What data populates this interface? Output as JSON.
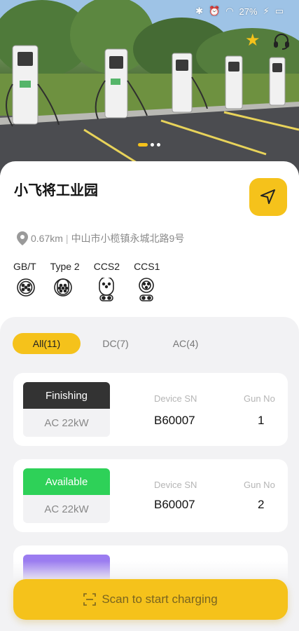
{
  "status_bar": {
    "battery": "27%"
  },
  "station": {
    "name": "小飞将工业园",
    "distance": "0.67km",
    "address": "中山市小榄镇永城北路9号"
  },
  "connectors": [
    {
      "label": "GB/T",
      "icon": "gbt-plug-icon"
    },
    {
      "label": "Type 2",
      "icon": "type2-plug-icon"
    },
    {
      "label": "CCS2",
      "icon": "ccs2-plug-icon"
    },
    {
      "label": "CCS1",
      "icon": "ccs1-plug-icon"
    }
  ],
  "tabs": [
    {
      "label": "All(11)",
      "active": true
    },
    {
      "label": "DC(7)",
      "active": false
    },
    {
      "label": "AC(4)",
      "active": false
    }
  ],
  "devices": [
    {
      "status": "Finishing",
      "status_color": "#333333",
      "power": "AC 22kW",
      "sn_label": "Device SN",
      "sn": "B60007",
      "gun_label": "Gun No",
      "gun": "1"
    },
    {
      "status": "Available",
      "status_color": "#2ed158",
      "power": "AC 22kW",
      "sn_label": "Device SN",
      "sn": "B60007",
      "gun_label": "Gun No",
      "gun": "2"
    }
  ],
  "partial_device_color": "#9b7cf0",
  "actions": {
    "scan_label": "Scan to start charging"
  },
  "colors": {
    "accent": "#f5c21b"
  }
}
